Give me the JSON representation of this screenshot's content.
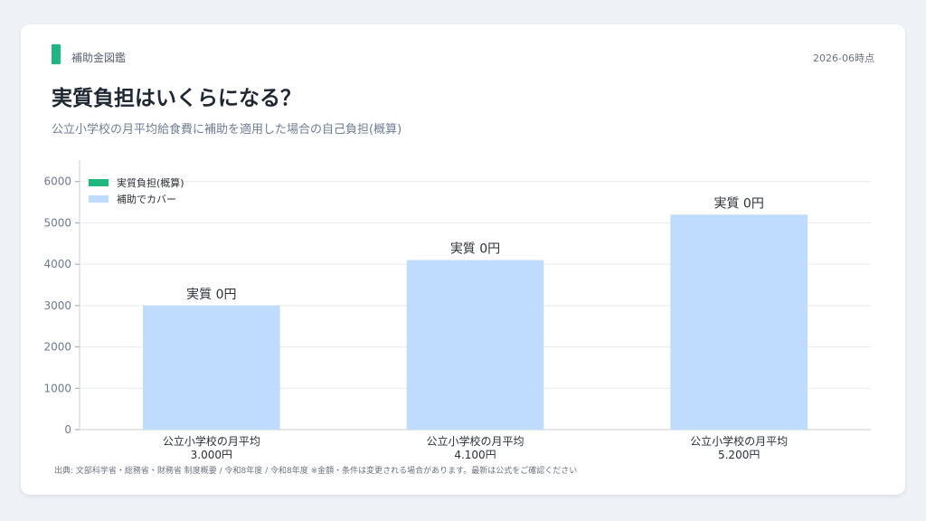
{
  "header": {
    "brand": "補助金図鑑",
    "date": "2026-06時点",
    "title": "実質負担はいくらになる？",
    "subtitle": "公立小学校の月平均給食費に補助を適用した場合の自己負担(概算)"
  },
  "footer": {
    "source": "出典: 文部科学省・総務省・財務省 制度概要 / 令和8年度 / 令和8年度 ※金額・条件は変更される場合があります。最新は公式をご確認ください"
  },
  "colors": {
    "burden": "#1fb77f",
    "covered": "#bfdbfe",
    "accent": "#1fb77f"
  },
  "chart_data": {
    "type": "bar",
    "stacked": true,
    "categories": [
      [
        "公立小学校の月平均",
        "3,000円"
      ],
      [
        "公立小学校の月平均",
        "4,100円"
      ],
      [
        "公立小学校の月平均",
        "5,200円"
      ]
    ],
    "series": [
      {
        "name": "実質負担(概算)",
        "values": [
          0,
          0,
          0
        ],
        "color": "#1fb77f"
      },
      {
        "name": "補助でカバー",
        "values": [
          3000,
          4100,
          5200
        ],
        "color": "#bfdbfe"
      }
    ],
    "data_labels": [
      "実質 0円",
      "実質 0円",
      "実質 0円"
    ],
    "yticks": [
      0,
      1000,
      2000,
      3000,
      4000,
      5000,
      6000
    ],
    "ylim": [
      0,
      6300
    ],
    "grid": true,
    "legend_position": "top-left"
  }
}
